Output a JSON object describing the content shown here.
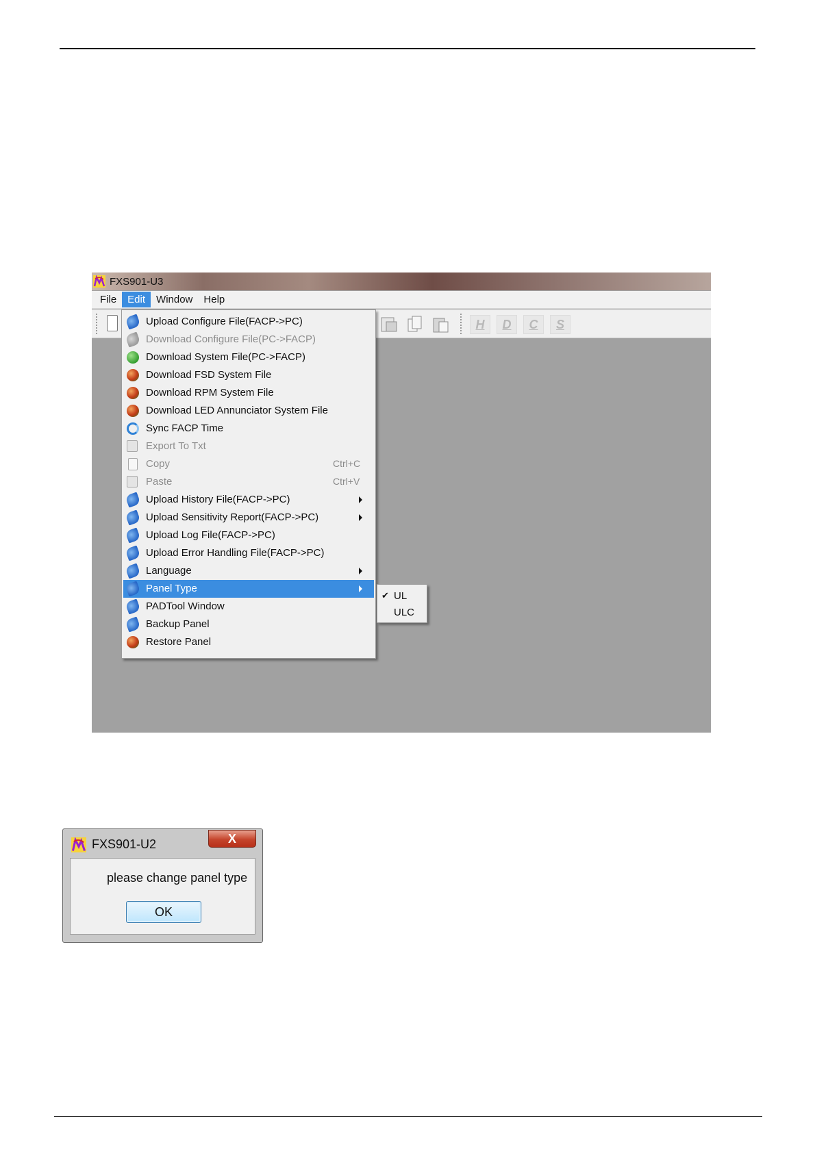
{
  "app": {
    "title": "FXS901-U3",
    "menubar": [
      "File",
      "Edit",
      "Window",
      "Help"
    ],
    "active_menu": "Edit",
    "toolbar_letters": [
      "H",
      "D",
      "C",
      "S"
    ]
  },
  "edit_menu": {
    "items": [
      {
        "label": "Upload Configure File(FACP->PC)",
        "icon": "upload-arrow-icon",
        "enabled": true
      },
      {
        "label": "Download Configure File(PC->FACP)",
        "icon": "download-arrow-icon",
        "enabled": false
      },
      {
        "label": "Download System File(PC->FACP)",
        "icon": "green-download-icon",
        "enabled": true
      },
      {
        "label": "Download FSD System File",
        "icon": "red-download-icon",
        "enabled": true
      },
      {
        "label": "Download RPM System File",
        "icon": "red-download-icon",
        "enabled": true
      },
      {
        "label": "Download LED Annunciator System File",
        "icon": "red-download-icon",
        "enabled": true
      },
      {
        "label": "Sync FACP Time",
        "icon": "sync-icon",
        "enabled": true
      },
      {
        "label": "Export To Txt",
        "icon": "export-icon",
        "enabled": false
      },
      {
        "label": "Copy",
        "icon": "copy-icon",
        "enabled": false,
        "shortcut": "Ctrl+C"
      },
      {
        "label": "Paste",
        "icon": "paste-icon",
        "enabled": false,
        "shortcut": "Ctrl+V"
      },
      {
        "label": "Upload History File(FACP->PC)",
        "icon": "upload-arrow-icon",
        "enabled": true,
        "submenu": true
      },
      {
        "label": "Upload Sensitivity Report(FACP->PC)",
        "icon": "upload-arrow-icon",
        "enabled": true,
        "submenu": true
      },
      {
        "label": "Upload Log File(FACP->PC)",
        "icon": "upload-arrow-icon",
        "enabled": true
      },
      {
        "label": "Upload Error Handling File(FACP->PC)",
        "icon": "upload-arrow-icon",
        "enabled": true
      },
      {
        "label": "Language",
        "icon": "upload-arrow-icon",
        "enabled": true,
        "submenu": true
      },
      {
        "label": "Panel Type",
        "icon": "upload-arrow-icon",
        "enabled": true,
        "submenu": true,
        "selected": true
      },
      {
        "label": "PADTool Window",
        "icon": "upload-arrow-icon",
        "enabled": true
      },
      {
        "label": "Backup Panel",
        "icon": "upload-arrow-icon",
        "enabled": true
      },
      {
        "label": "Restore Panel",
        "icon": "red-download-icon",
        "enabled": true
      }
    ]
  },
  "panel_type_submenu": {
    "items": [
      {
        "label": "UL",
        "checked": true,
        "check": "✔"
      },
      {
        "label": "ULC",
        "checked": false,
        "check": ""
      }
    ]
  },
  "dialog": {
    "title": "FXS901-U2",
    "close_glyph": "X",
    "message": "please change panel type",
    "ok_label": "OK"
  },
  "colors": {
    "selection": "#3b8de0",
    "workspace": "#a1a1a1",
    "menu_bg": "#f0f0f0"
  }
}
